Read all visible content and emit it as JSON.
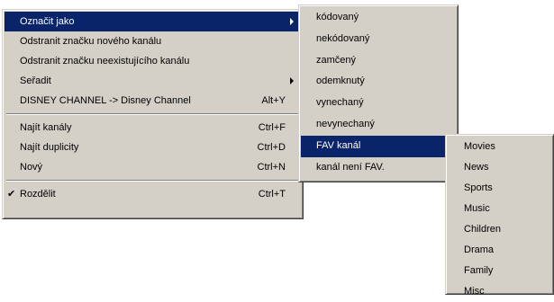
{
  "main_menu": {
    "items": [
      {
        "label": "Označit jako",
        "shortcut": "",
        "submenu": true,
        "highlighted": true,
        "checked": false
      },
      {
        "label": "Odstranit značku nového kanálu",
        "shortcut": "",
        "submenu": false
      },
      {
        "label": "Odstranit značku neexistujícího kanálu",
        "shortcut": "",
        "submenu": false
      },
      {
        "label": "Seřadit",
        "shortcut": "",
        "submenu": true
      },
      {
        "label": "DISNEY CHANNEL -> Disney Channel",
        "shortcut": "Alt+Y",
        "submenu": false
      },
      {
        "label": "Najít kanály",
        "shortcut": "Ctrl+F",
        "submenu": false
      },
      {
        "label": "Najít duplicity",
        "shortcut": "Ctrl+D",
        "submenu": false
      },
      {
        "label": "Nový",
        "shortcut": "Ctrl+N",
        "submenu": false
      },
      {
        "label": "Rozdělit",
        "shortcut": "Ctrl+T",
        "submenu": false,
        "checked": true,
        "check_mark": "✔"
      }
    ]
  },
  "mark_submenu": {
    "items": [
      {
        "label": "kódovaný"
      },
      {
        "label": "nekódovaný"
      },
      {
        "label": "zamčený"
      },
      {
        "label": "odemknutý"
      },
      {
        "label": "vynechaný"
      },
      {
        "label": "nevynechaný"
      },
      {
        "label": "FAV kanál",
        "submenu": true,
        "highlighted": true
      },
      {
        "label": "kanál není FAV."
      }
    ]
  },
  "fav_submenu": {
    "items": [
      {
        "label": "Movies"
      },
      {
        "label": "News"
      },
      {
        "label": "Sports"
      },
      {
        "label": "Music"
      },
      {
        "label": "Children"
      },
      {
        "label": "Drama"
      },
      {
        "label": "Family"
      },
      {
        "label": "Misc"
      }
    ]
  },
  "colors": {
    "menu_bg": "#d4d0c8",
    "highlight_bg": "#0a246a",
    "highlight_text": "#ffffff"
  }
}
